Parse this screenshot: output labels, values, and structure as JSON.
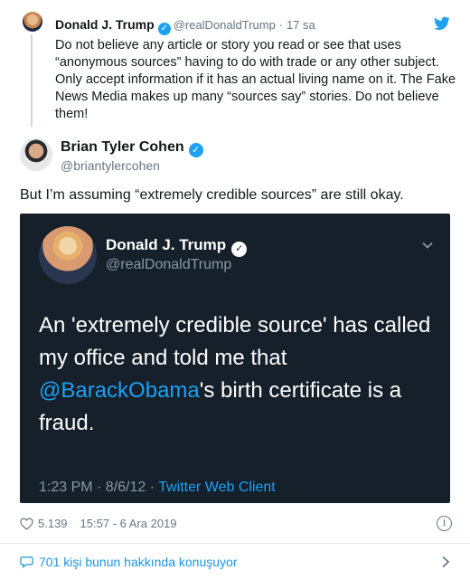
{
  "parent_tweet": {
    "name": "Donald J. Trump",
    "handle": "@realDonaldTrump",
    "separator": "·",
    "time": "17 sa",
    "text": "Do not believe any article or story you read or see that uses “anonymous sources” having to do with trade or any other subject. Only accept information if it has an actual living name on it. The Fake News Media makes up many “sources say” stories. Do not believe them!"
  },
  "main_tweet": {
    "name": "Brian Tyler Cohen",
    "handle": "@briantylercohen",
    "text": "But I’m assuming “extremely credible sources” are still okay."
  },
  "embedded_tweet": {
    "name": "Donald J. Trump",
    "handle": "@realDonaldTrump",
    "text_before": "An 'extremely credible source' has called my office and told me that ",
    "mention": "@BarackObama",
    "text_after": "'s birth certificate is a fraud.",
    "timestamp": "1:23 PM · 8/6/12 · ",
    "client": "Twitter Web Client"
  },
  "stats": {
    "likes": "5.139",
    "datetime": "15:57 - 6 Ara 2019"
  },
  "conversation": {
    "label": "701 kişi bunun hakkında konuşuyor"
  },
  "colors": {
    "brand_blue": "#1da1f2",
    "link_blue": "#1b95e0",
    "dark_bg": "#15202b",
    "muted_gray": "#657786"
  },
  "icons": {
    "verified": "verified-badge-icon",
    "bird": "twitter-bird-icon",
    "heart": "heart-icon",
    "info": "info-icon",
    "bubble": "comment-bubble-icon",
    "chevron": "chevron-right-icon"
  }
}
